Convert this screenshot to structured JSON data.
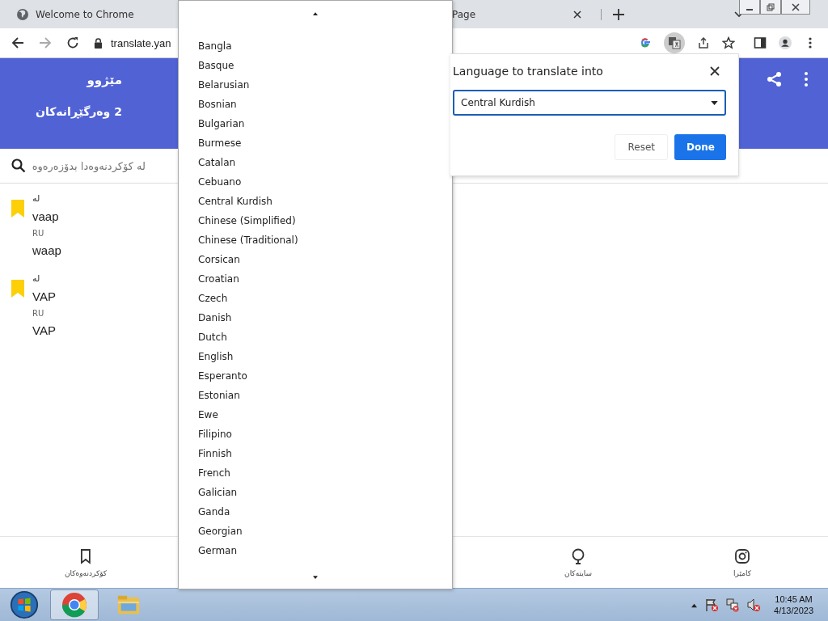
{
  "browser": {
    "tabs": [
      {
        "title": "Welcome to Chrome"
      },
      {
        "title": "Page"
      }
    ],
    "address": "translate.yan"
  },
  "page": {
    "header": {
      "title": "مێژوو",
      "subtitle": "2 وەرگێڕانەکان"
    },
    "search": {
      "placeholder": "لە کۆکردنەوەدا بدۆزەرەوە"
    },
    "entries": [
      {
        "from_label": "لە",
        "source": "vaap",
        "lang": "RU",
        "translation": "waap"
      },
      {
        "from_label": "لە",
        "source": "VAP",
        "lang": "RU",
        "translation": "VAP"
      }
    ],
    "bottom_nav": [
      {
        "label": "کامێرا",
        "kind": "camera"
      },
      {
        "label": "سایتەکان",
        "kind": "sites"
      },
      {
        "label": "کۆکردنەوەکان",
        "kind": "collections"
      }
    ]
  },
  "language_dropdown": {
    "options": [
      "Bangla",
      "Basque",
      "Belarusian",
      "Bosnian",
      "Bulgarian",
      "Burmese",
      "Catalan",
      "Cebuano",
      "Central Kurdish",
      "Chinese (Simplified)",
      "Chinese (Traditional)",
      "Corsican",
      "Croatian",
      "Czech",
      "Danish",
      "Dutch",
      "English",
      "Esperanto",
      "Estonian",
      "Ewe",
      "Filipino",
      "Finnish",
      "French",
      "Galician",
      "Ganda",
      "Georgian",
      "German"
    ]
  },
  "translate_bubble": {
    "title": "Language to translate into",
    "value": "Central Kurdish",
    "buttons": [
      {
        "label": "Reset",
        "kind": "secondary"
      },
      {
        "label": "Done",
        "kind": "primary"
      }
    ]
  },
  "taskbar": {
    "time": "10:45 AM",
    "date": "4/13/2023"
  }
}
